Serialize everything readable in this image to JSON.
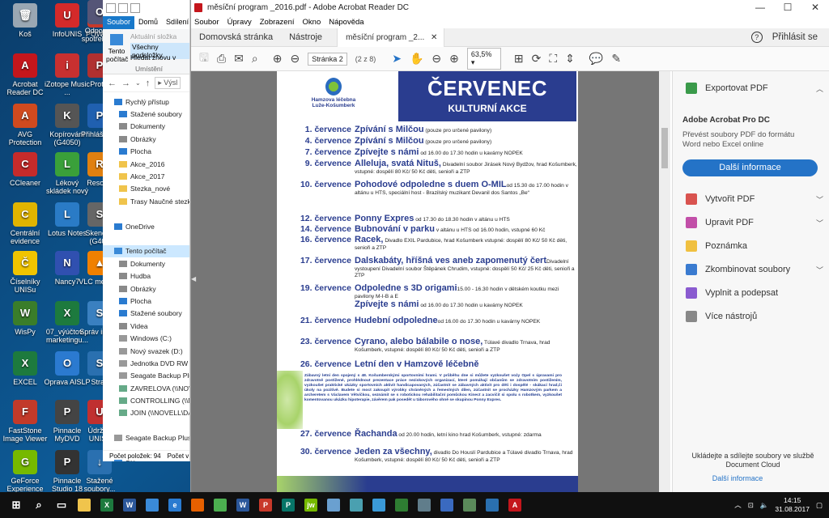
{
  "desktop_icons": [
    {
      "label": "Koš",
      "color": "#9aa7b3",
      "glyph": "🗑"
    },
    {
      "label": "Acrobat Reader DC",
      "color": "#c4161c",
      "glyph": "A"
    },
    {
      "label": "AVG Protection",
      "color": "#d04a1f",
      "glyph": "A"
    },
    {
      "label": "CCleaner",
      "color": "#c62b2b",
      "glyph": "C"
    },
    {
      "label": "Centrální evidence",
      "color": "#e0b400",
      "glyph": "C"
    },
    {
      "label": "Číselníky UNISu",
      "color": "#f0c400",
      "glyph": "Č"
    },
    {
      "label": "WisPy",
      "color": "#3a7d2a",
      "glyph": "W"
    },
    {
      "label": "EXCEL",
      "color": "#1d7a3e",
      "glyph": "X"
    },
    {
      "label": "FastStone Image Viewer",
      "color": "#c23a2a",
      "glyph": "F"
    },
    {
      "label": "GeForce Experience",
      "color": "#76b900",
      "glyph": "G"
    },
    {
      "label": "InfoUNIS",
      "color": "#d42a2a",
      "glyph": "U"
    },
    {
      "label": "iZotope Music ...",
      "color": "#c83030",
      "glyph": "i"
    },
    {
      "label": "Kopírování (G4050)",
      "color": "#555",
      "glyph": "K"
    },
    {
      "label": "Lékový skládek nový",
      "color": "#3aa03a",
      "glyph": "L"
    },
    {
      "label": "Lotus Notes",
      "color": "#2a7bc6",
      "glyph": "L"
    },
    {
      "label": "Nancy7",
      "color": "#3050b0",
      "glyph": "N"
    },
    {
      "label": "07_výúčtov... marketingu...",
      "color": "#1d7a3e",
      "glyph": "X"
    },
    {
      "label": "Oprava AISLP",
      "color": "#2b7ad0",
      "glyph": "O"
    },
    {
      "label": "Pinnacle MyDVD",
      "color": "#444",
      "glyph": "P"
    },
    {
      "label": "Pinnacle Studio 18",
      "color": "#333",
      "glyph": "P"
    },
    {
      "label": "POWER",
      "color": "#c8392a",
      "glyph": "P"
    },
    {
      "label": "Protel",
      "color": "#b03030",
      "glyph": "P"
    },
    {
      "label": "Přihláše siti",
      "color": "#2060b0",
      "glyph": "P"
    },
    {
      "label": "Resortn",
      "color": "#e08010",
      "glyph": "R"
    },
    {
      "label": "Skenova (G405",
      "color": "#666",
      "glyph": "S"
    },
    {
      "label": "VLC me play",
      "color": "#f08000",
      "glyph": "▲"
    },
    {
      "label": "Správ incide",
      "color": "#3a80c0",
      "glyph": "S"
    },
    {
      "label": "Strav",
      "color": "#2a70b0",
      "glyph": "S"
    },
    {
      "label": "Údržba UNISu",
      "color": "#c03030",
      "glyph": "U"
    },
    {
      "label": "Stažené soubory...",
      "color": "#2a70b0",
      "glyph": "↓"
    },
    {
      "label": "Odpojení spotřebni...",
      "color": "#557",
      "glyph": "O"
    }
  ],
  "explorer": {
    "ribbon_tabs": [
      "Soubor",
      "Domů",
      "Sdílení"
    ],
    "ribbon_items": [
      "Aktuální složka",
      "Všechny podsložky",
      "Hledat znovu v"
    ],
    "ribbon_pin": "Tento počítač",
    "ribbon_group": "Umístění",
    "nav_path": "Výsl",
    "tree": [
      {
        "label": "Rychlý přístup",
        "color": "#2a7bd0"
      },
      {
        "label": "Stažené soubory",
        "color": "#2a7bd0"
      },
      {
        "label": "Dokumenty",
        "color": "#8a8a8a"
      },
      {
        "label": "Obrázky",
        "color": "#8a8a8a"
      },
      {
        "label": "Plocha",
        "color": "#2a7bd0"
      },
      {
        "label": "Akce_2016",
        "color": "#f0c44c"
      },
      {
        "label": "Akce_2017",
        "color": "#f0c44c"
      },
      {
        "label": "Stezka_nové",
        "color": "#f0c44c"
      },
      {
        "label": "Trasy Naučné stezky",
        "color": "#f0c44c"
      },
      {
        "label": "",
        "color": "transparent"
      },
      {
        "label": "OneDrive",
        "color": "#2a7bd0"
      },
      {
        "label": "",
        "color": "transparent"
      },
      {
        "label": "Tento počítač",
        "color": "#3a8ad8"
      },
      {
        "label": "Dokumenty",
        "color": "#8a8a8a"
      },
      {
        "label": "Hudba",
        "color": "#8a8a8a"
      },
      {
        "label": "Obrázky",
        "color": "#8a8a8a"
      },
      {
        "label": "Plocha",
        "color": "#2a7bd0"
      },
      {
        "label": "Stažené soubory",
        "color": "#2a7bd0"
      },
      {
        "label": "Videa",
        "color": "#8a8a8a"
      },
      {
        "label": "Windows (C:)",
        "color": "#999"
      },
      {
        "label": "Nový svazek (D:)",
        "color": "#999"
      },
      {
        "label": "Jednotka DVD RW (E:)",
        "color": "#999"
      },
      {
        "label": "Seagate Backup Plus D",
        "color": "#999"
      },
      {
        "label": "ZAVRELOVA (\\\\NOVELL",
        "color": "#6a8"
      },
      {
        "label": "CONTROLLING (\\\\NOC",
        "color": "#6a8"
      },
      {
        "label": "JOIN (\\\\NOVELL\\DATA",
        "color": "#6a8"
      },
      {
        "label": "",
        "color": "transparent"
      },
      {
        "label": "Seagate Backup Plus Dr",
        "color": "#999"
      },
      {
        "label": "",
        "color": "transparent"
      },
      {
        "label": "Síť",
        "color": "#3a8ad8"
      }
    ],
    "status_count": "Počet položek: 94",
    "status_selected": "Počet v"
  },
  "reader": {
    "title": "měsíční program _2016.pdf - Adobe Acrobat Reader DC",
    "menu": [
      "Soubor",
      "Úpravy",
      "Zobrazení",
      "Okno",
      "Nápověda"
    ],
    "tab_home": "Domovská stránka",
    "tab_tools": "Nástroje",
    "tab_doc": "měsíční program _2...",
    "help": "?",
    "signin": "Přihlásit se",
    "page_field": "Stránka 2",
    "page_of": "(2 z 8)",
    "zoom": "63,5%"
  },
  "pdf": {
    "month": "ČERVENEC",
    "subtitle": "KULTURNÍ AKCE",
    "logo_line1": "Hamzova léčebna",
    "logo_line2": "Luže-Košumberk",
    "events": [
      {
        "date": "1. července",
        "name": "Zpívání s Milčou",
        "detail": " (pouze pro určené pavilony)"
      },
      {
        "date": "4. července",
        "name": "Zpívání s Milčou",
        "detail": " (pouze pro určené pavilony)"
      },
      {
        "date": "7. července",
        "name": "Zpívejte s námi",
        "detail": " od 16.00 do 17.30 hodin u kavárny NOPEK"
      },
      {
        "date": "9. července",
        "name": "Alleluja, svatá Nituš,",
        "detail": " Divadelní soubor Jirásek Nový Bydžov, hrad Košumberk, vstupné: dospělí 80 Kč/ 50 Kč děti, senioři a ZTP"
      },
      {
        "date": "10. července",
        "name": "Pohodové odpoledne s duem O-MIL",
        "detail": "od 15.30 do 17.00 hodin v altánu u HTS, speciální host - Brazilský muzikant Devanil dos Santos „Be“"
      },
      {
        "date": "12. července",
        "name": "Ponny Expres",
        "detail": " od 17.30 do 18.30 hodin v altánu u HTS"
      },
      {
        "date": "14. července",
        "name": "Bubnování v parku",
        "detail": " v altánu u HTS od 16.00 hodin, vstupné 60 Kč"
      },
      {
        "date": "16. července",
        "name": "Racek,",
        "detail": " Divadlo EXIL Pardubice, hrad Košumberk vstupné: dospělí 80 Kč/ 50 Kč děti, senioři a ZTP"
      },
      {
        "date": "17. července",
        "name": "Dalskabáty, hříšná ves aneb zapomenutý čert",
        "detail": "Divadelní vystoupení Divadelní soubor Štěpánek Chrudim, vstupné: dospělí 50 Kč/ 25 Kč děti, senioři a ZTP"
      },
      {
        "date": "19. července",
        "name": "Odpoledne s 3D origami",
        "detail": "15.00 - 16.30 hodin v dětském koutku mezi pavilony M-I-B a E"
      },
      {
        "date": "",
        "name": "Zpívejte s námi",
        "detail": " od 16.00 do 17.30 hodin u kavárny NOPEK"
      },
      {
        "date": "21. července",
        "name": "Hudební odpoledne",
        "detail": "od 16.00 do 17.30 hodin u kavárny NOPEK"
      },
      {
        "date": "23. července",
        "name": "Cyrano, alebo bálabile o nose,",
        "detail": " Túlavé divadlo Trnava, hrad Košumberk, vstupné: dospělí 80 Kč/ 50 Kč děti, senioři a ZTP"
      },
      {
        "date": "26. července",
        "name": "Letní den v Hamzově léčebně",
        "detail": ""
      },
      {
        "date": "27. července",
        "name": "Řachanda",
        "detail": " od 20.00 hodin, letní kino hrad Košumberk, vstupné: zdarma"
      },
      {
        "date": "30. července",
        "name": "Jeden za všechny,",
        "detail": " divadlo Do Houslí Pardubice a Túlavé divadlo Trnava, hrad Košumberk, vstupné: dospělí 80 Kč/ 50 Kč děti, senioři a ZTP"
      }
    ],
    "blurb": "Zábavný letní den spojený s 48. Košumberskými sportovními hrami. V průběhu dne si můžete vyzkoušet voży Opel s úpravami pro zdravotně postižené, prohlédnout prezentace práce neziskových organizací, které pomáhají občanům se zdravotním postižením, vyzkoušet praktické ukázky sportovních aktivit handicapovaných, zúčastnit se zábavných aktivit pro děti i dospělé - skákací hrad,či úkoly na pozitivě. Budete si moct zakoupit výrobky chráněných a řemeslných dílen, zúčastnit se procházky Hamzovým parkem a archeretem s Václavem Větvičkou, seznámit se s robotickou rehabilitační pomůckou Kinect a zacvičit si spolu s robotkem, vyzkoušet komentovanou ukázku hipoterapie, závěrem pak posedět u táborového ohně se skupinou Ponny Expres."
  },
  "right_pane": {
    "export_label": "Exportovat PDF",
    "product": "Adobe Acrobat Pro DC",
    "description": "Převést soubory PDF do formátu Word nebo Excel online",
    "more_button": "Další informace",
    "tools": [
      {
        "label": "Vytvořit PDF",
        "color": "#d9534f",
        "chev": true
      },
      {
        "label": "Upravit PDF",
        "color": "#c24fa8",
        "chev": true
      },
      {
        "label": "Poznámka",
        "color": "#f0c040",
        "chev": false
      },
      {
        "label": "Zkombinovat soubory",
        "color": "#3a7bd0",
        "chev": true
      },
      {
        "label": "Vyplnit a podepsat",
        "color": "#8a5bd0",
        "chev": false
      },
      {
        "label": "Více nástrojů",
        "color": "#888",
        "chev": false
      }
    ],
    "cloud_text": "Ukládejte a sdílejte soubory ve službě Document Cloud",
    "cloud_link": "Další informace"
  },
  "taskbar": {
    "time": "14:15",
    "date": "31.08.2017",
    "apps": [
      {
        "name": "start",
        "color": "#fff",
        "glyph": "⊞"
      },
      {
        "name": "search",
        "color": "#fff",
        "glyph": "⌕"
      },
      {
        "name": "task-view",
        "color": "#fff",
        "glyph": "▭"
      },
      {
        "name": "explorer",
        "color": "#f0c44c",
        "glyph": ""
      },
      {
        "name": "excel",
        "color": "#1d7a3e",
        "glyph": "X"
      },
      {
        "name": "word",
        "color": "#2b579a",
        "glyph": "W"
      },
      {
        "name": "store",
        "color": "#3a8ad8",
        "glyph": ""
      },
      {
        "name": "edge",
        "color": "#2a7bd0",
        "glyph": "e"
      },
      {
        "name": "firefox",
        "color": "#e66000",
        "glyph": ""
      },
      {
        "name": "chrome",
        "color": "#4caf50",
        "glyph": ""
      },
      {
        "name": "word2",
        "color": "#2b579a",
        "glyph": "W"
      },
      {
        "name": "powerpoint",
        "color": "#c8392a",
        "glyph": "P"
      },
      {
        "name": "publisher",
        "color": "#077568",
        "glyph": "P"
      },
      {
        "name": "jw",
        "color": "#76b900",
        "glyph": "jw"
      },
      {
        "name": "app-a",
        "color": "#6aa0d0",
        "glyph": ""
      },
      {
        "name": "app-b",
        "color": "#4aa0b0",
        "glyph": ""
      },
      {
        "name": "app-c",
        "color": "#3a9ad8",
        "glyph": ""
      },
      {
        "name": "app-d",
        "color": "#2e7d32",
        "glyph": ""
      },
      {
        "name": "app-e",
        "color": "#607d8b",
        "glyph": ""
      },
      {
        "name": "app-f",
        "color": "#3a6ac0",
        "glyph": ""
      },
      {
        "name": "app-g",
        "color": "#5a8a5a",
        "glyph": ""
      },
      {
        "name": "app-h",
        "color": "#2a70b0",
        "glyph": ""
      },
      {
        "name": "acrobat",
        "color": "#c4161c",
        "glyph": "A"
      }
    ]
  }
}
